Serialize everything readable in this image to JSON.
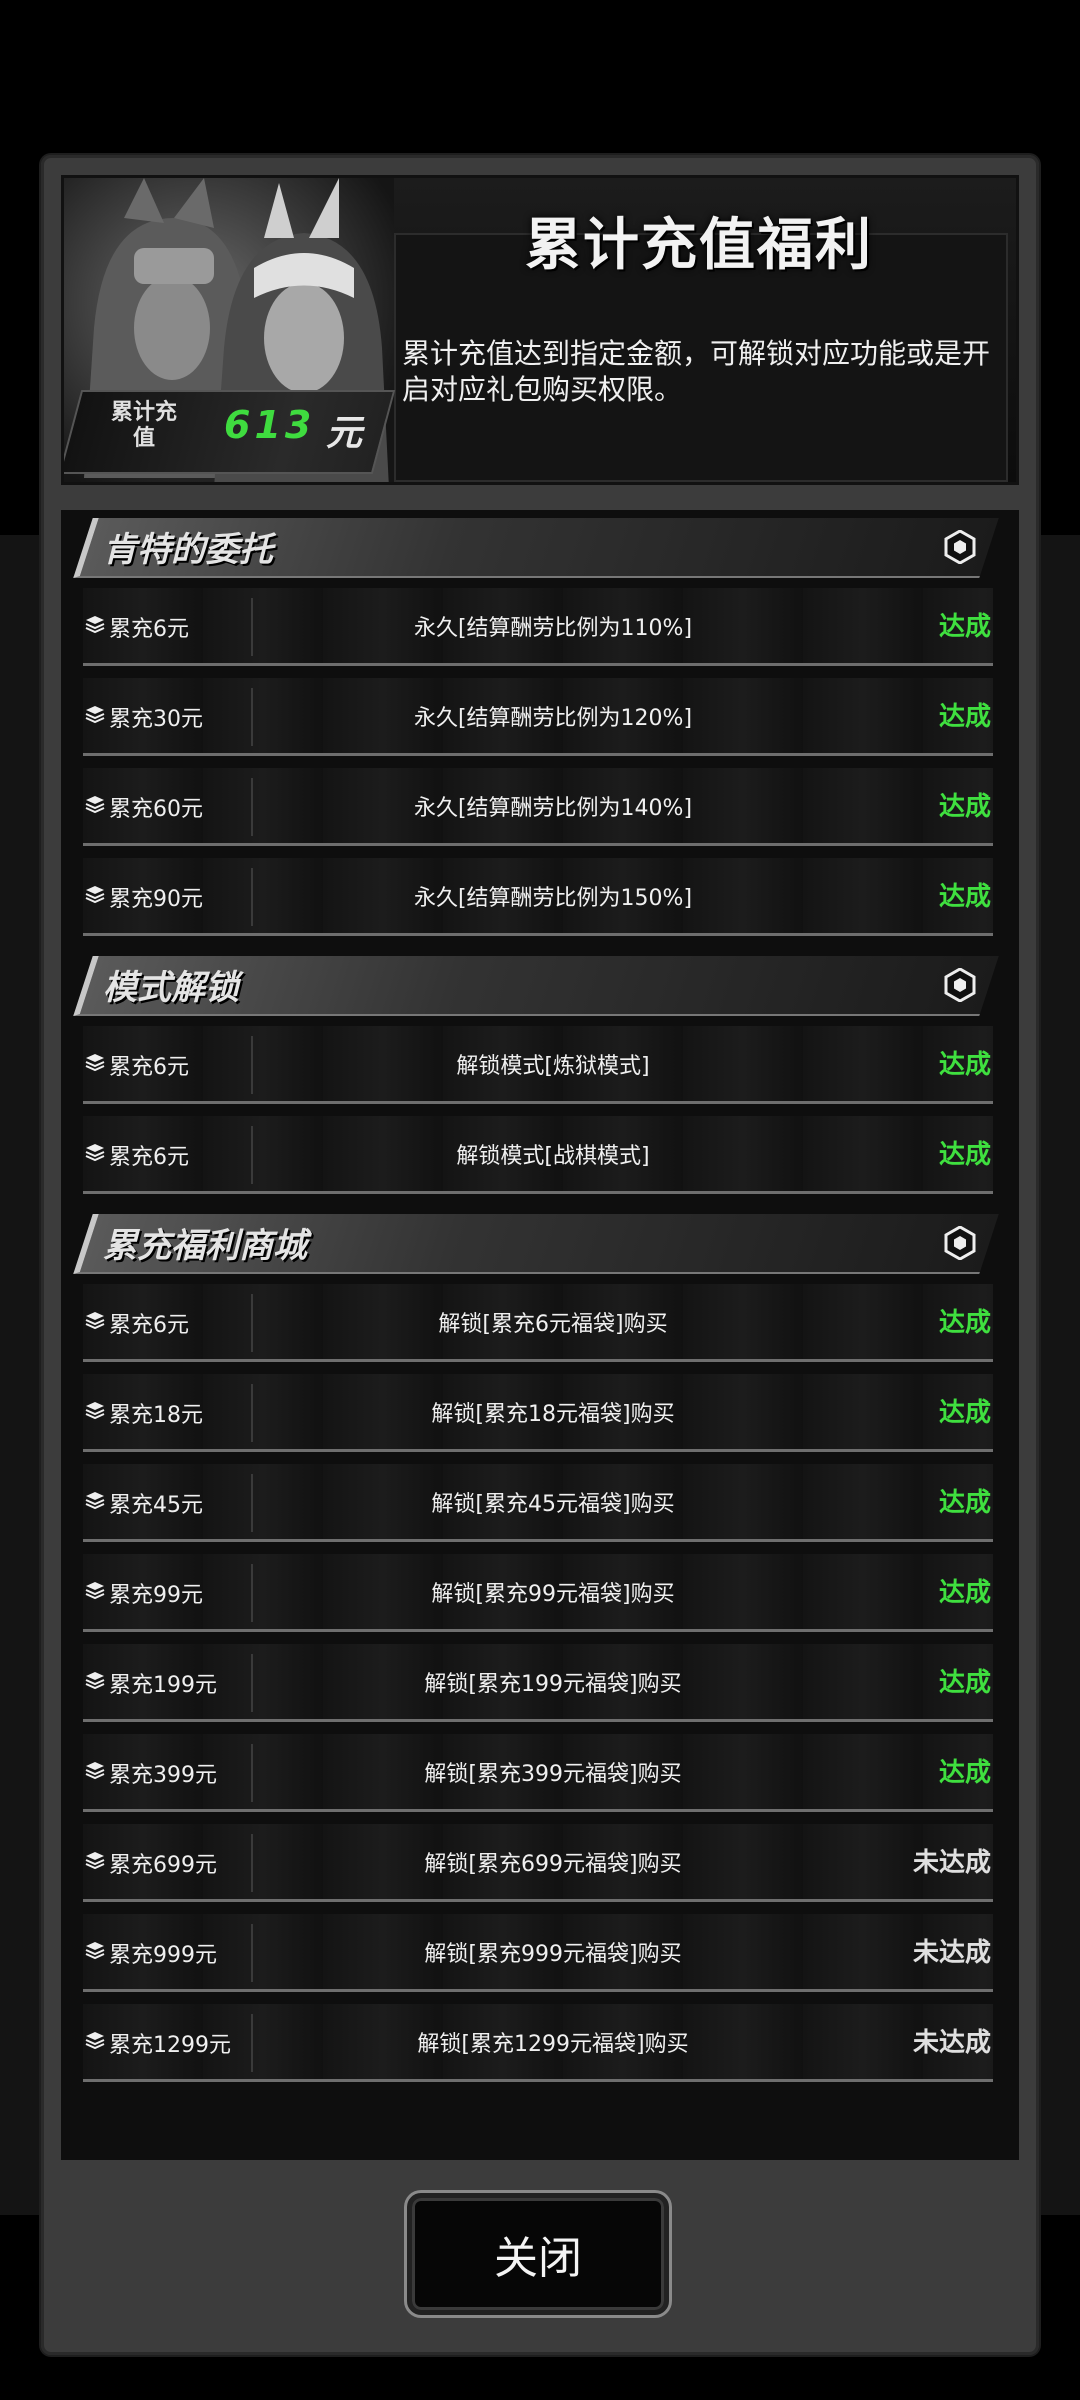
{
  "header": {
    "title": "累计充值福利",
    "description": "累计充值达到指定金额，可解锁对应功能或是开启对应礼包购买权限。",
    "recharge_label": "累计充值",
    "recharge_value": "613",
    "recharge_unit": "元"
  },
  "sections": [
    {
      "title": "肯特的委托",
      "rows": [
        {
          "req": "累充6元",
          "desc": "永久[结算酬劳比例为110%]",
          "status": "达成"
        },
        {
          "req": "累充30元",
          "desc": "永久[结算酬劳比例为120%]",
          "status": "达成"
        },
        {
          "req": "累充60元",
          "desc": "永久[结算酬劳比例为140%]",
          "status": "达成"
        },
        {
          "req": "累充90元",
          "desc": "永久[结算酬劳比例为150%]",
          "status": "达成"
        }
      ]
    },
    {
      "title": "模式解锁",
      "rows": [
        {
          "req": "累充6元",
          "desc": "解锁模式[炼狱模式]",
          "status": "达成"
        },
        {
          "req": "累充6元",
          "desc": "解锁模式[战棋模式]",
          "status": "达成"
        }
      ]
    },
    {
      "title": "累充福利商城",
      "rows": [
        {
          "req": "累充6元",
          "desc": "解锁[累充6元福袋]购买",
          "status": "达成"
        },
        {
          "req": "累充18元",
          "desc": "解锁[累充18元福袋]购买",
          "status": "达成"
        },
        {
          "req": "累充45元",
          "desc": "解锁[累充45元福袋]购买",
          "status": "达成"
        },
        {
          "req": "累充99元",
          "desc": "解锁[累充99元福袋]购买",
          "status": "达成"
        },
        {
          "req": "累充199元",
          "desc": "解锁[累充199元福袋]购买",
          "status": "达成"
        },
        {
          "req": "累充399元",
          "desc": "解锁[累充399元福袋]购买",
          "status": "达成"
        },
        {
          "req": "累充699元",
          "desc": "解锁[累充699元福袋]购买",
          "status": "未达成"
        },
        {
          "req": "累充999元",
          "desc": "解锁[累充999元福袋]购买",
          "status": "未达成"
        },
        {
          "req": "累充1299元",
          "desc": "解锁[累充1299元福袋]购买",
          "status": "未达成"
        }
      ]
    }
  ],
  "icons": {
    "row_icon": "layers-icon",
    "section_icon": "hexagon-icon"
  },
  "colors": {
    "done": "#3fe03f",
    "todo": "#e0e0e0"
  },
  "close_button": {
    "label": "关闭"
  }
}
